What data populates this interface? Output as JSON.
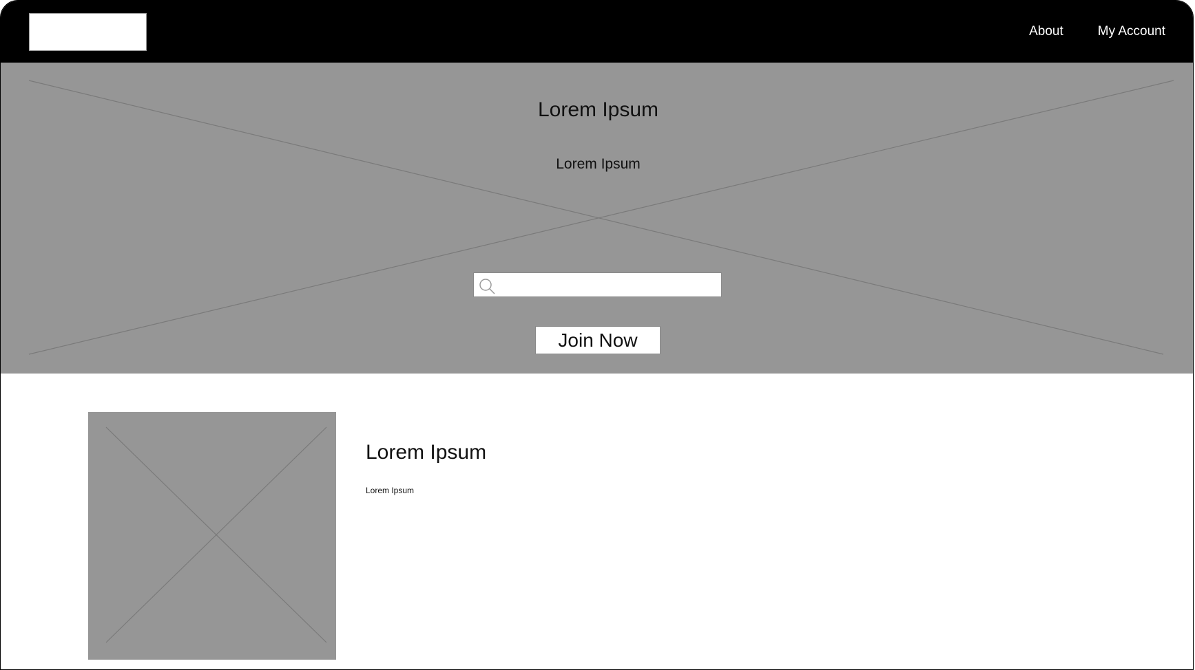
{
  "header": {
    "nav": [
      {
        "label": "About"
      },
      {
        "label": "My Account"
      }
    ]
  },
  "hero": {
    "title": "Lorem Ipsum",
    "subtitle": "Lorem Ipsum",
    "search": {
      "value": "",
      "placeholder": "",
      "icon": "search-icon"
    },
    "join_label": "Join Now",
    "background_color": "#969696"
  },
  "feature": {
    "title": "Lorem Ipsum",
    "text": "Lorem Ipsum"
  },
  "colors": {
    "header": "#000000",
    "placeholder_gray": "#969696",
    "page": "#ffffff"
  }
}
